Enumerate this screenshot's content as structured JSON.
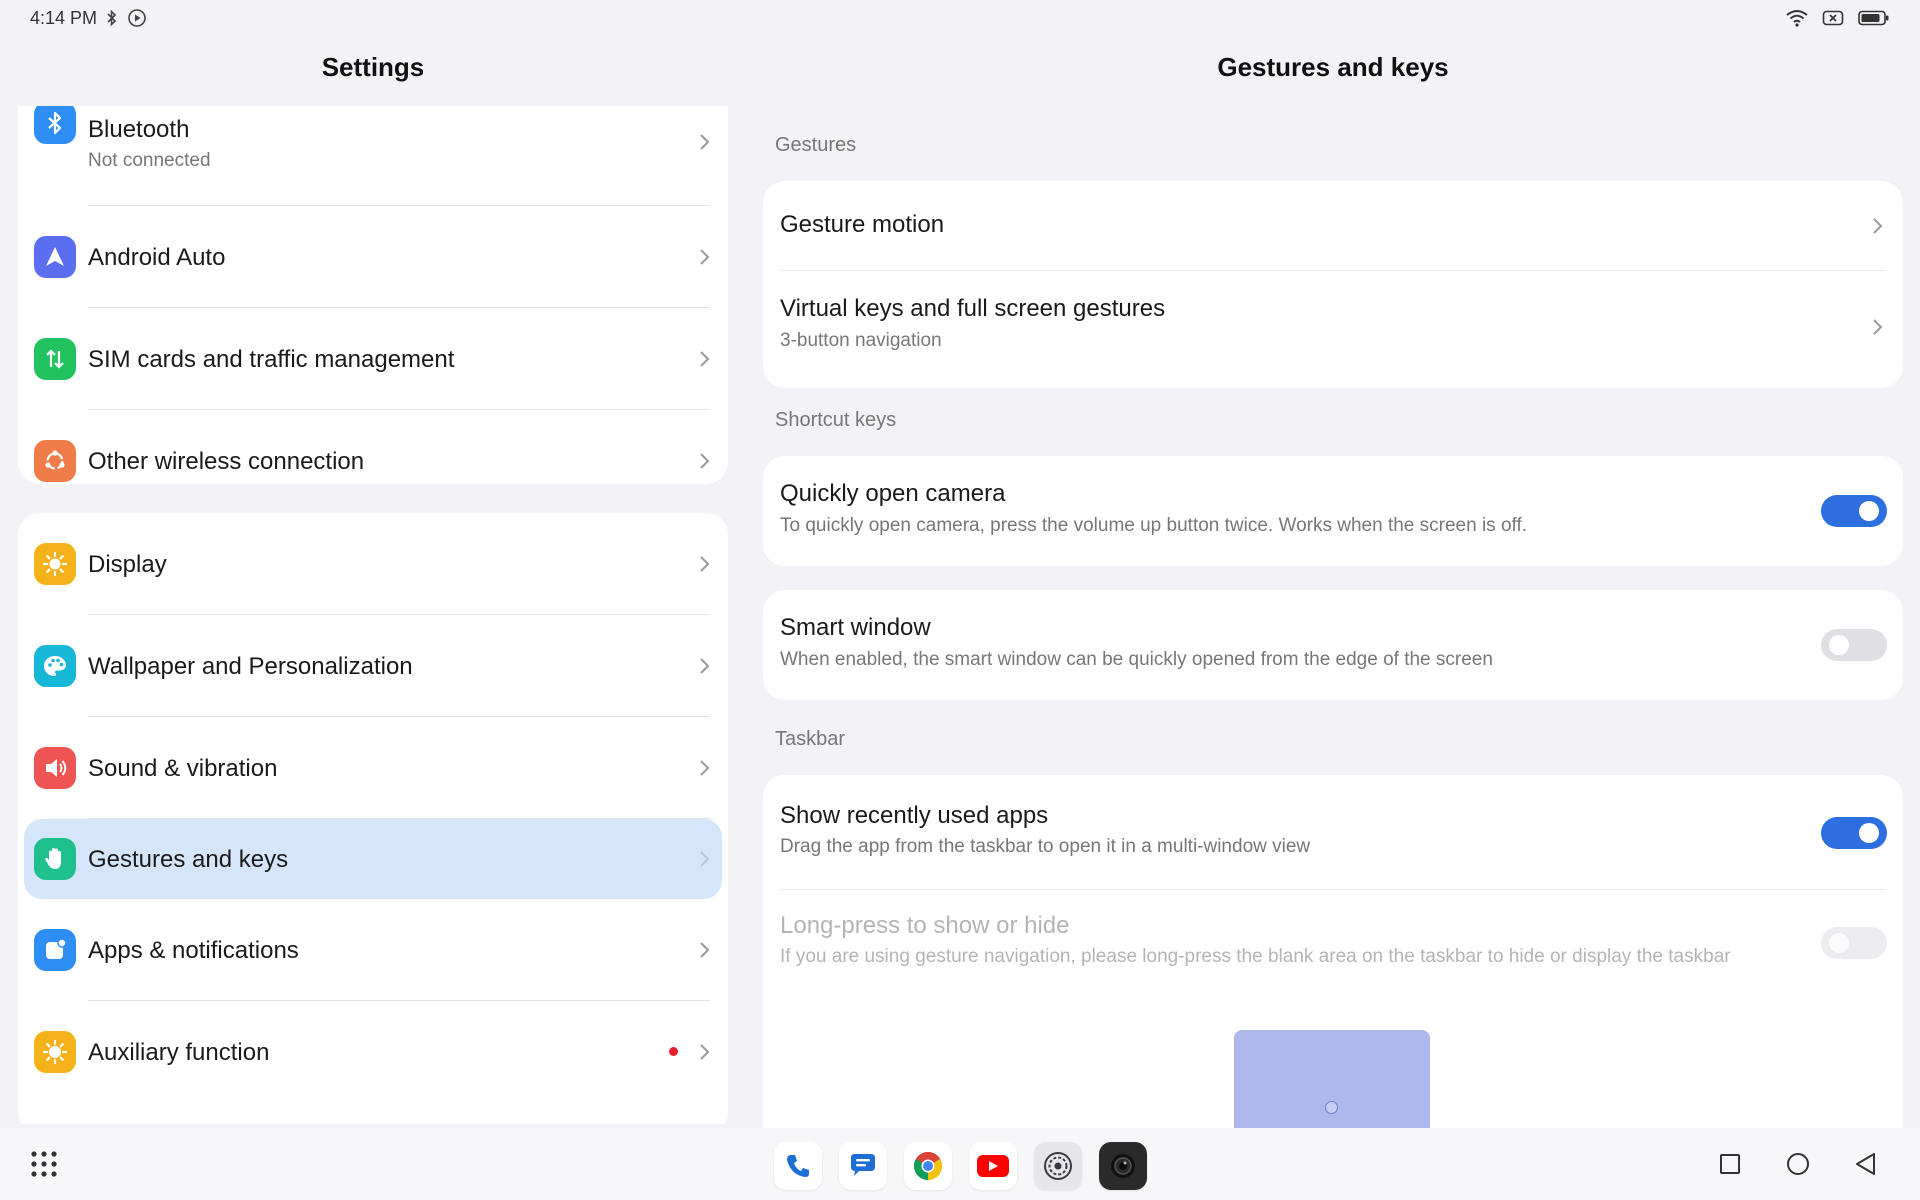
{
  "status_bar": {
    "time": "4:14 PM",
    "left_icons": [
      "bluetooth-icon",
      "media-playing-icon"
    ],
    "right_icons": [
      "wifi-icon",
      "no-sim-icon",
      "battery-icon"
    ]
  },
  "left_pane": {
    "title": "Settings",
    "groups": [
      {
        "items": [
          {
            "label": "Bluetooth",
            "sublabel": "Not connected",
            "icon": "bluetooth-icon",
            "color": "#2f8ef4"
          },
          {
            "label": "Android Auto",
            "icon": "android-auto-icon",
            "color": "#5b6ef0"
          },
          {
            "label": "SIM cards and traffic management",
            "icon": "sim-traffic-icon",
            "color": "#22c35e"
          },
          {
            "label": "Other wireless connection",
            "icon": "wireless-connection-icon",
            "color": "#f07c4a"
          }
        ]
      },
      {
        "items": [
          {
            "label": "Display",
            "icon": "display-brightness-icon",
            "color": "#f6b21b"
          },
          {
            "label": "Wallpaper and Personalization",
            "icon": "palette-icon",
            "color": "#17b7d8"
          },
          {
            "label": "Sound & vibration",
            "icon": "speaker-icon",
            "color": "#ef5454"
          },
          {
            "label": "Gestures and keys",
            "icon": "hand-icon",
            "color": "#1fbf8e",
            "selected": true
          },
          {
            "label": "Apps & notifications",
            "icon": "apps-icon",
            "color": "#2f8ef4"
          },
          {
            "label": "Auxiliary function",
            "icon": "auxiliary-icon",
            "color": "#f6b21b",
            "badge": "red-dot"
          }
        ]
      }
    ]
  },
  "right_pane": {
    "title": "Gestures and keys",
    "sections": {
      "gestures": {
        "label": "Gestures",
        "items": [
          {
            "title": "Gesture motion"
          },
          {
            "title": "Virtual keys and full screen gestures",
            "subtitle": "3-button navigation"
          }
        ]
      },
      "shortcut_keys": {
        "label": "Shortcut keys",
        "items": [
          {
            "title": "Quickly open camera",
            "subtitle": "To quickly open camera, press the volume up button twice. Works when the screen is off.",
            "toggle": "on"
          },
          {
            "title": "Smart window",
            "subtitle": "When enabled, the smart window can be quickly opened from the edge of the screen",
            "toggle": "off"
          }
        ]
      },
      "taskbar": {
        "label": "Taskbar",
        "items": [
          {
            "title": "Show recently used apps",
            "subtitle": "Drag the app from the taskbar to open it in a multi-window view",
            "toggle": "on"
          },
          {
            "title": "Long-press to show or hide",
            "subtitle": "If you are using gesture navigation, please long-press the blank area on the taskbar to hide or display the taskbar",
            "toggle": "off",
            "disabled": true
          }
        ]
      }
    }
  },
  "nav_bar": {
    "launcher_icon": "app-drawer-icon",
    "dock_apps": [
      "phone-app-icon",
      "messages-app-icon",
      "chrome-app-icon",
      "youtube-app-icon",
      "settings-app-icon",
      "camera-app-icon"
    ],
    "keys": [
      "recents-square-icon",
      "home-circle-icon",
      "back-triangle-icon"
    ]
  },
  "colors": {
    "accent": "#2e6fe0",
    "selected_row": "#d5e6fa",
    "background": "#f2f2f7",
    "badge": "#e5202e"
  }
}
